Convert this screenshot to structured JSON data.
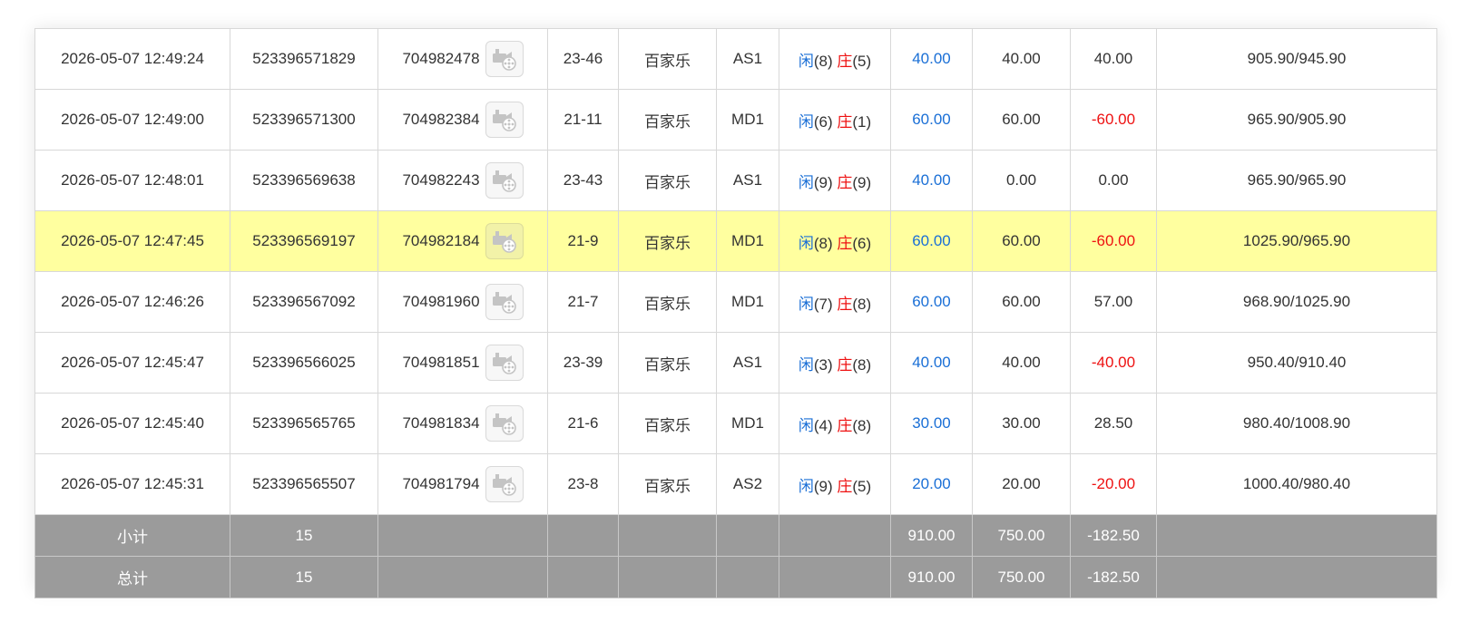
{
  "table": {
    "rows": [
      {
        "time": "2026-05-07 12:49:24",
        "order_id": "523396571829",
        "draw_id": "704982478",
        "table_no": "23-46",
        "game": "百家乐",
        "room": "AS1",
        "player_label": "闲",
        "player_score": "(8)",
        "banker_label": "庄",
        "banker_score": "(5)",
        "bet": "40.00",
        "valid_bet": "40.00",
        "win_loss": "40.00",
        "win_loss_color": "neutral",
        "balance": "905.90/945.90",
        "highlight": false
      },
      {
        "time": "2026-05-07 12:49:00",
        "order_id": "523396571300",
        "draw_id": "704982384",
        "table_no": "21-11",
        "game": "百家乐",
        "room": "MD1",
        "player_label": "闲",
        "player_score": "(6)",
        "banker_label": "庄",
        "banker_score": "(1)",
        "bet": "60.00",
        "valid_bet": "60.00",
        "win_loss": "-60.00",
        "win_loss_color": "red",
        "balance": "965.90/905.90",
        "highlight": false
      },
      {
        "time": "2026-05-07 12:48:01",
        "order_id": "523396569638",
        "draw_id": "704982243",
        "table_no": "23-43",
        "game": "百家乐",
        "room": "AS1",
        "player_label": "闲",
        "player_score": "(9)",
        "banker_label": "庄",
        "banker_score": "(9)",
        "bet": "40.00",
        "valid_bet": "0.00",
        "win_loss": "0.00",
        "win_loss_color": "neutral",
        "balance": "965.90/965.90",
        "highlight": false
      },
      {
        "time": "2026-05-07 12:47:45",
        "order_id": "523396569197",
        "draw_id": "704982184",
        "table_no": "21-9",
        "game": "百家乐",
        "room": "MD1",
        "player_label": "闲",
        "player_score": "(8)",
        "banker_label": "庄",
        "banker_score": "(6)",
        "bet": "60.00",
        "valid_bet": "60.00",
        "win_loss": "-60.00",
        "win_loss_color": "red",
        "balance": "1025.90/965.90",
        "highlight": true
      },
      {
        "time": "2026-05-07 12:46:26",
        "order_id": "523396567092",
        "draw_id": "704981960",
        "table_no": "21-7",
        "game": "百家乐",
        "room": "MD1",
        "player_label": "闲",
        "player_score": "(7)",
        "banker_label": "庄",
        "banker_score": "(8)",
        "bet": "60.00",
        "valid_bet": "60.00",
        "win_loss": "57.00",
        "win_loss_color": "neutral",
        "balance": "968.90/1025.90",
        "highlight": false
      },
      {
        "time": "2026-05-07 12:45:47",
        "order_id": "523396566025",
        "draw_id": "704981851",
        "table_no": "23-39",
        "game": "百家乐",
        "room": "AS1",
        "player_label": "闲",
        "player_score": "(3)",
        "banker_label": "庄",
        "banker_score": "(8)",
        "bet": "40.00",
        "valid_bet": "40.00",
        "win_loss": "-40.00",
        "win_loss_color": "red",
        "balance": "950.40/910.40",
        "highlight": false
      },
      {
        "time": "2026-05-07 12:45:40",
        "order_id": "523396565765",
        "draw_id": "704981834",
        "table_no": "21-6",
        "game": "百家乐",
        "room": "MD1",
        "player_label": "闲",
        "player_score": "(4)",
        "banker_label": "庄",
        "banker_score": "(8)",
        "bet": "30.00",
        "valid_bet": "30.00",
        "win_loss": "28.50",
        "win_loss_color": "neutral",
        "balance": "980.40/1008.90",
        "highlight": false
      },
      {
        "time": "2026-05-07 12:45:31",
        "order_id": "523396565507",
        "draw_id": "704981794",
        "table_no": "23-8",
        "game": "百家乐",
        "room": "AS2",
        "player_label": "闲",
        "player_score": "(9)",
        "banker_label": "庄",
        "banker_score": "(5)",
        "bet": "20.00",
        "valid_bet": "20.00",
        "win_loss": "-20.00",
        "win_loss_color": "red",
        "balance": "1000.40/980.40",
        "highlight": false
      }
    ],
    "subtotal": {
      "label": "小计",
      "count": "15",
      "bet": "910.00",
      "valid_bet": "750.00",
      "win_loss": "-182.50"
    },
    "total": {
      "label": "总计",
      "count": "15",
      "bet": "910.00",
      "valid_bet": "750.00",
      "win_loss": "-182.50"
    }
  },
  "icons": {
    "replay": "video-replay-icon"
  },
  "colors": {
    "player": "#1a6fd6",
    "banker": "#ee1111",
    "bet": "#1a6fd6",
    "loss": "#ee1111",
    "highlight_row": "#ffff9f",
    "summary_row": "#9b9b9b"
  }
}
